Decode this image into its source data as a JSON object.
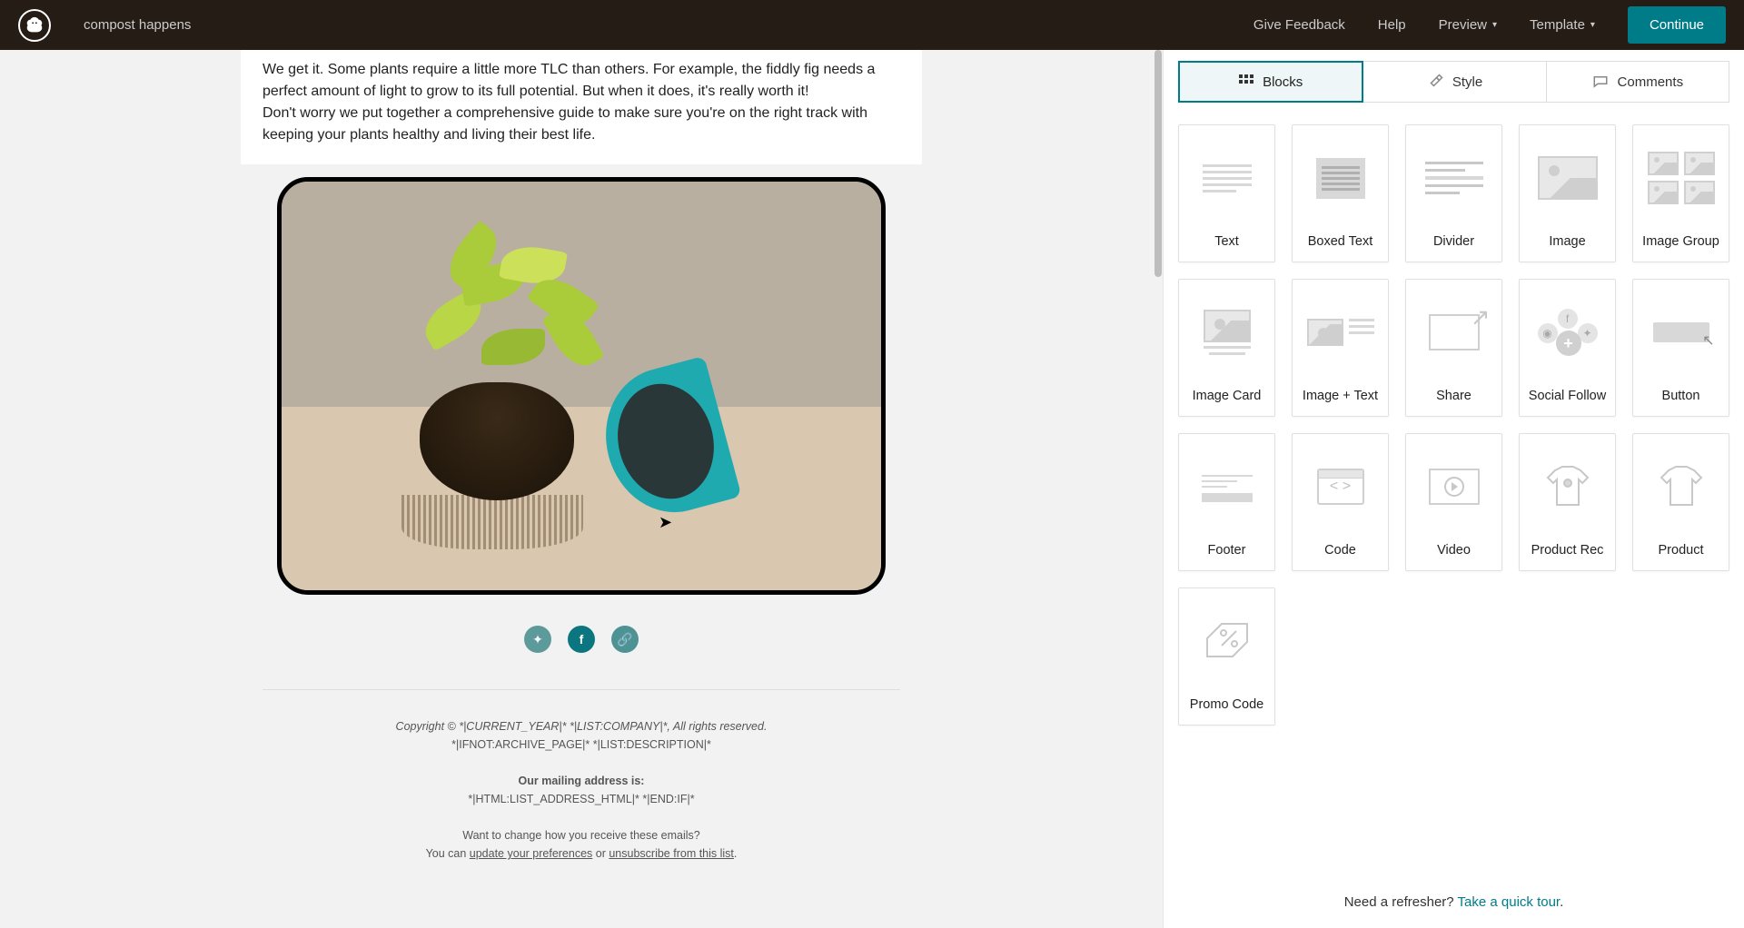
{
  "header": {
    "campaign_name": "compost happens",
    "links": {
      "feedback": "Give Feedback",
      "help": "Help",
      "preview": "Preview",
      "template": "Template"
    },
    "continue": "Continue"
  },
  "email": {
    "text_p1": "We get it. Some plants require a little more TLC than others. For example, the fiddly fig needs a perfect amount of light to grow to its full potential. But when it does, it's really worth it!",
    "text_p2": "Don't worry we put together a comprehensive guide to make sure you're on the right track with keeping your plants healthy and living their best life.",
    "footer": {
      "copyright": "Copyright © *|CURRENT_YEAR|* *|LIST:COMPANY|*, All rights reserved.",
      "archive": "*|IFNOT:ARCHIVE_PAGE|* *|LIST:DESCRIPTION|*",
      "mailing_label": "Our mailing address is:",
      "mailing_address": "*|HTML:LIST_ADDRESS_HTML|* *|END:IF|*",
      "change_q": "Want to change how you receive these emails?",
      "change_prefix": "You can ",
      "update_link": "update your preferences",
      "or": " or ",
      "unsub_link": "unsubscribe from this list",
      "period": "."
    }
  },
  "sidebar": {
    "tabs": {
      "blocks": "Blocks",
      "style": "Style",
      "comments": "Comments"
    },
    "blocks": {
      "text": "Text",
      "boxed_text": "Boxed Text",
      "divider": "Divider",
      "image": "Image",
      "image_group": "Image Group",
      "image_card": "Image Card",
      "image_text": "Image + Text",
      "share": "Share",
      "social_follow": "Social Follow",
      "button": "Button",
      "footer": "Footer",
      "code": "Code",
      "video": "Video",
      "product_rec": "Product Rec",
      "product": "Product",
      "promo_code": "Promo Code"
    },
    "refresher_prefix": "Need a refresher? ",
    "refresher_link": "Take a quick tour",
    "refresher_suffix": "."
  }
}
